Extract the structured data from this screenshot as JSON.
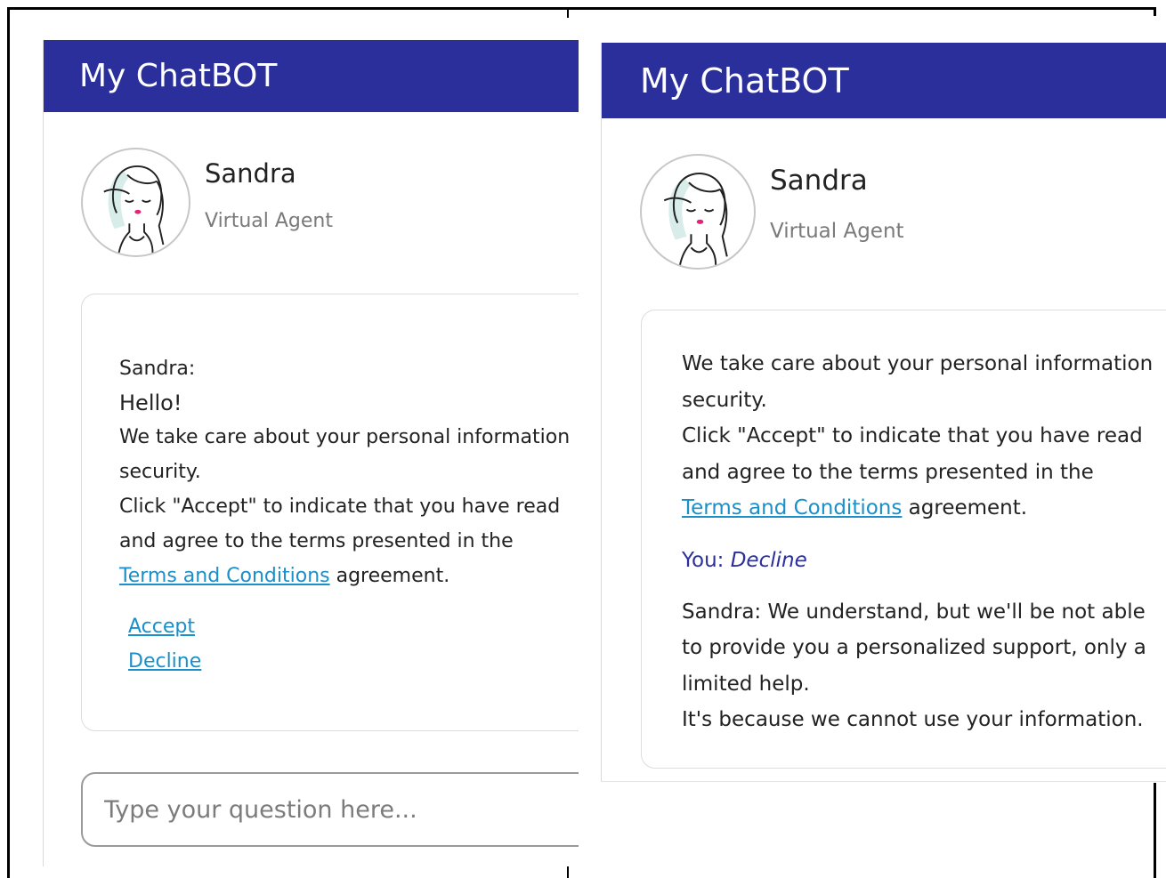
{
  "panels": [
    {
      "header": "My ChatBOT",
      "agent": {
        "name": "Sandra",
        "role": "Virtual Agent"
      },
      "bubble": {
        "sender": "Sandra:",
        "greeting": "Hello!",
        "line1": "We take care about your personal information",
        "line2": "security.",
        "line3": "Click \"Accept\" to indicate that you have read",
        "line4": "and agree to the terms presented in the",
        "link": "Terms and Conditions",
        "link_suffix": " agreement.",
        "accept": "Accept",
        "decline": "Decline"
      },
      "input": {
        "placeholder": "Type your question here..."
      }
    },
    {
      "header": "My ChatBOT",
      "agent": {
        "name": "Sandra",
        "role": "Virtual Agent"
      },
      "bubble": {
        "line1": "We take care about your personal information",
        "line2": "security.",
        "line3": "Click \"Accept\" to indicate that you have read",
        "line4": "and agree to the terms presented in the",
        "link": "Terms and Conditions",
        "link_suffix": " agreement.",
        "you_label": "You: ",
        "you_choice": "Decline",
        "reply1": "Sandra: We understand, but we'll be not able",
        "reply2": "to provide you a personalized support, only a",
        "reply3": "limited help.",
        "reply4": "It's because we cannot use your information."
      }
    }
  ],
  "colors": {
    "header_bg": "#2a2f9c",
    "link": "#1a8fc9",
    "you_text": "#2a2f9c"
  }
}
